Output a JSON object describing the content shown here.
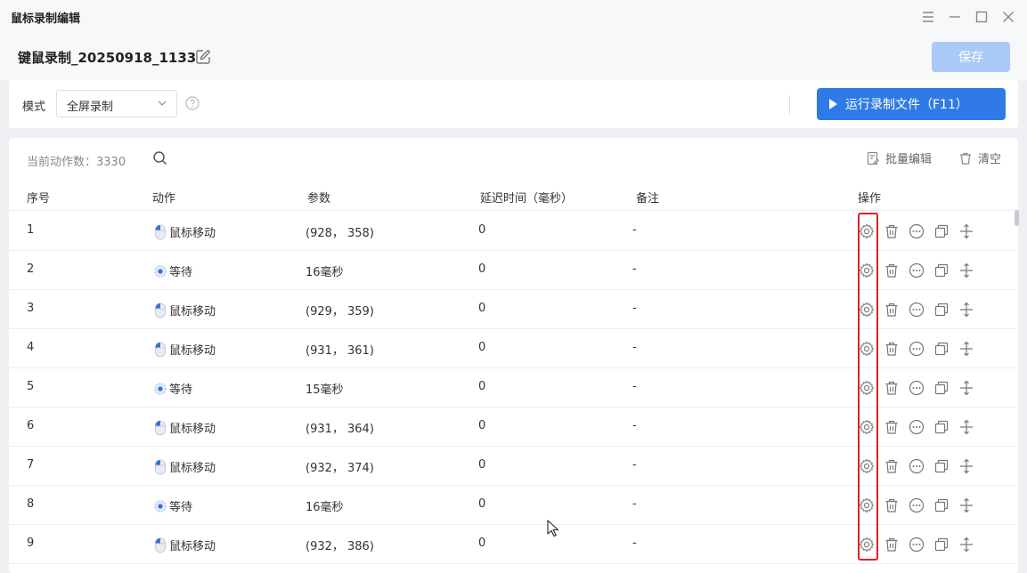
{
  "window": {
    "title": "鼠标录制编辑"
  },
  "header": {
    "file_name": "键鼠录制_20250918_1133",
    "save_label": "保存"
  },
  "mode": {
    "label": "模式",
    "selected": "全屏录制"
  },
  "run": {
    "label": "运行录制文件（F11）"
  },
  "toolbar": {
    "count_text": "当前动作数：3330",
    "batch_edit": "批量编辑",
    "clear": "清空"
  },
  "columns": {
    "index": "序号",
    "action": "动作",
    "params": "参数",
    "delay": "延迟时间（毫秒）",
    "note": "备注",
    "ops": "操作"
  },
  "rows": [
    {
      "index": "1",
      "type": "mouse",
      "action": "鼠标移动",
      "params": "(928， 358)",
      "delay": "0",
      "note": "-"
    },
    {
      "index": "2",
      "type": "wait",
      "action": "等待",
      "params": "16毫秒",
      "delay": "0",
      "note": "-"
    },
    {
      "index": "3",
      "type": "mouse",
      "action": "鼠标移动",
      "params": "(929， 359)",
      "delay": "0",
      "note": "-"
    },
    {
      "index": "4",
      "type": "mouse",
      "action": "鼠标移动",
      "params": "(931， 361)",
      "delay": "0",
      "note": "-"
    },
    {
      "index": "5",
      "type": "wait",
      "action": "等待",
      "params": "15毫秒",
      "delay": "0",
      "note": "-"
    },
    {
      "index": "6",
      "type": "mouse",
      "action": "鼠标移动",
      "params": "(931， 364)",
      "delay": "0",
      "note": "-"
    },
    {
      "index": "7",
      "type": "mouse",
      "action": "鼠标移动",
      "params": "(932， 374)",
      "delay": "0",
      "note": "-"
    },
    {
      "index": "8",
      "type": "wait",
      "action": "等待",
      "params": "16毫秒",
      "delay": "0",
      "note": "-"
    },
    {
      "index": "9",
      "type": "mouse",
      "action": "鼠标移动",
      "params": "(932， 386)",
      "delay": "0",
      "note": "-"
    }
  ],
  "icons": {
    "row_ops": [
      "gear-icon",
      "trash-icon",
      "more-icon",
      "copy-icon",
      "move-icon"
    ],
    "action_types": {
      "mouse": "mouse-icon",
      "wait": "gear-wait-icon"
    }
  },
  "colors": {
    "primary": "#2f7ae6",
    "save_disabled": "#a9c9f7",
    "highlight": "#e02020"
  }
}
